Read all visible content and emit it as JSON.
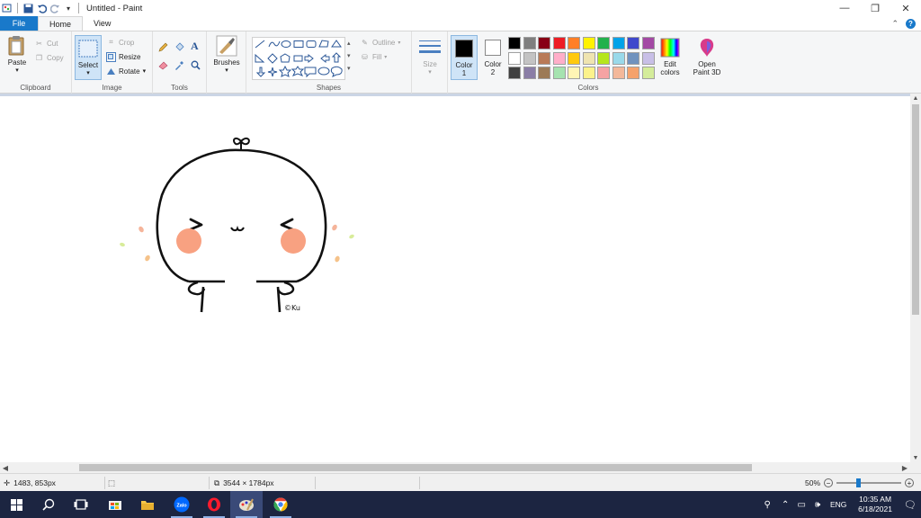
{
  "window": {
    "title": "Untitled - Paint",
    "minimize": "—",
    "restore": "❐",
    "close": "✕"
  },
  "tabs": {
    "file": "File",
    "home": "Home",
    "view": "View"
  },
  "ribbon": {
    "clipboard": {
      "label": "Clipboard",
      "paste": "Paste",
      "cut": "Cut",
      "copy": "Copy"
    },
    "image": {
      "label": "Image",
      "select": "Select",
      "crop": "Crop",
      "resize": "Resize",
      "rotate": "Rotate"
    },
    "tools": {
      "label": "Tools"
    },
    "brushes": {
      "label": "Brushes"
    },
    "shapes": {
      "label": "Shapes",
      "outline": "Outline",
      "fill": "Fill"
    },
    "size": {
      "label": "Size"
    },
    "colors": {
      "label": "Colors",
      "color1": "Color 1",
      "color2": "Color 2",
      "edit_colors": "Edit colors",
      "open_paint3d": "Open Paint 3D",
      "color1_value": "#000000",
      "color2_value": "#ffffff",
      "palette_row1": [
        "#000000",
        "#7f7f7f",
        "#880015",
        "#ed1c24",
        "#ff7f27",
        "#fff200",
        "#22b14c",
        "#00a2e8",
        "#3f48cc",
        "#a349a4"
      ],
      "palette_row2": [
        "#ffffff",
        "#c3c3c3",
        "#b97a57",
        "#ffaec9",
        "#ffc90e",
        "#efe4b0",
        "#b5e61d",
        "#99d9ea",
        "#7092be",
        "#c8bfe7"
      ],
      "palette_row3": [
        "#404040",
        "#8a7ea6",
        "#9c7a56",
        "#a6e3b0",
        "#fff5b5",
        "#fcf28c",
        "#f5a3a3",
        "#f3b89a",
        "#f5a26c",
        "#d4ec9a"
      ]
    }
  },
  "canvas": {
    "signature": "©Ku"
  },
  "status": {
    "cursor_pos": "1483, 853px",
    "image_size": "3544 × 1784px",
    "zoom": "50%"
  },
  "taskbar": {
    "time": "10:35 AM",
    "date": "6/18/2021",
    "lang": "ENG"
  }
}
